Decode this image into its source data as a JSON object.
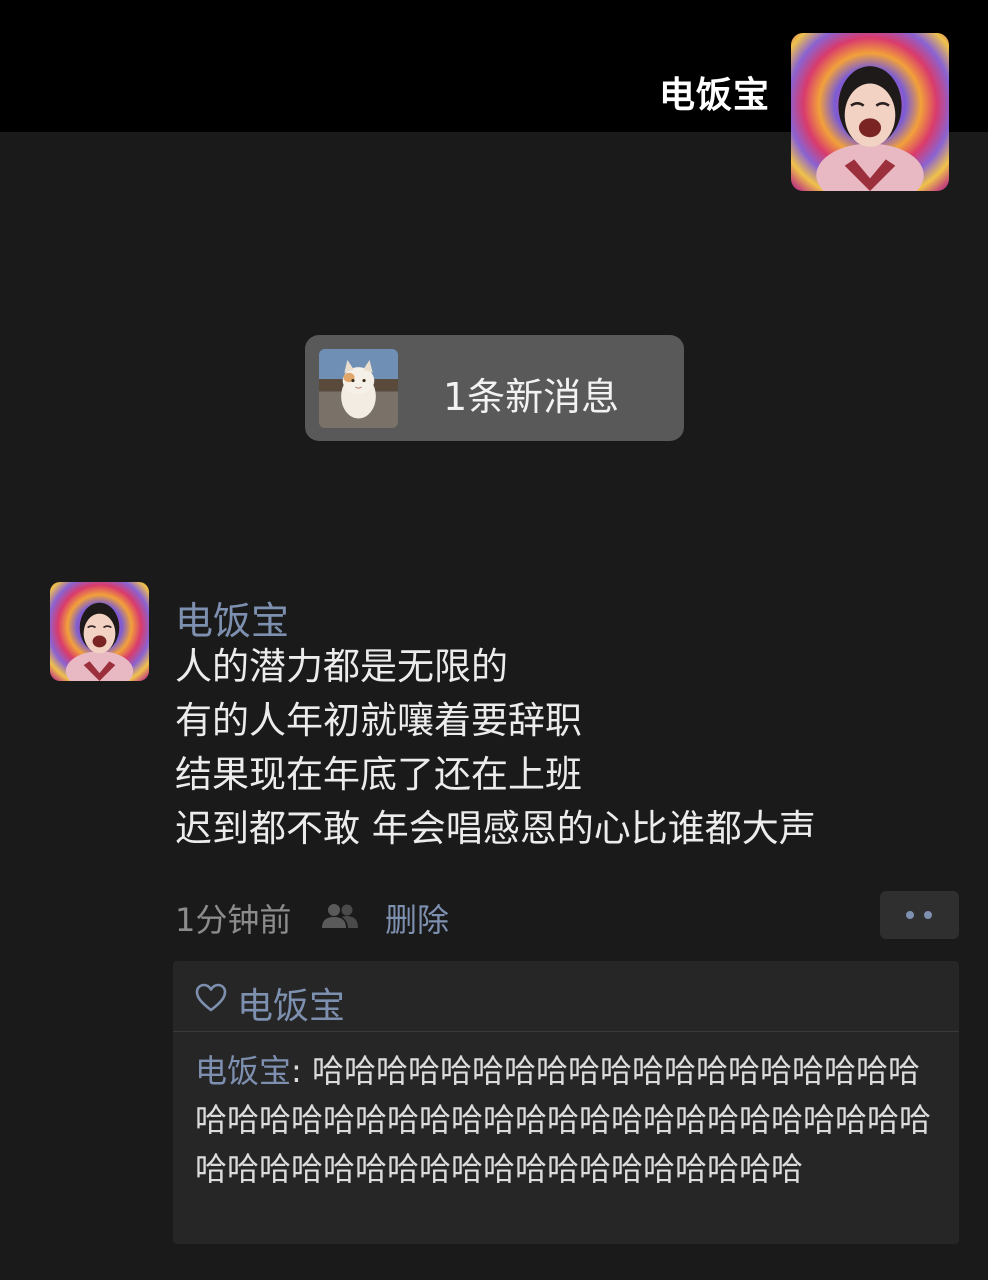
{
  "cover": {
    "user_name": "电饭宝"
  },
  "new_message": {
    "label": "1条新消息"
  },
  "post": {
    "author": "电饭宝",
    "lines": [
      "人的潜力都是无限的",
      "有的人年初就嚷着要辞职",
      "结果现在年底了还在上班",
      "迟到都不敢 年会唱感恩的心比谁都大声"
    ],
    "time": "1分钟前",
    "delete_label": "删除"
  },
  "likes": {
    "names": "电饭宝"
  },
  "comments": [
    {
      "author": "电饭宝",
      "separator": ": ",
      "text": "哈哈哈哈哈哈哈哈哈哈哈哈哈哈哈哈哈哈哈哈哈哈哈哈哈哈哈哈哈哈哈哈哈哈哈哈哈哈哈哈哈哈哈哈哈哈哈哈哈哈哈哈哈哈哈哈哈哈哈哈哈"
    }
  ],
  "icons": {
    "friends": "friends-visibility-icon",
    "heart": "heart-outline-icon",
    "more": "more-dots-icon"
  },
  "colors": {
    "background": "#1a1a1a",
    "cover": "#000000",
    "name_link": "#7e90b0",
    "text": "#ececec",
    "secondary_text": "#8c8c8c",
    "new_message_bg": "#595959",
    "interaction_bg": "#262626"
  }
}
